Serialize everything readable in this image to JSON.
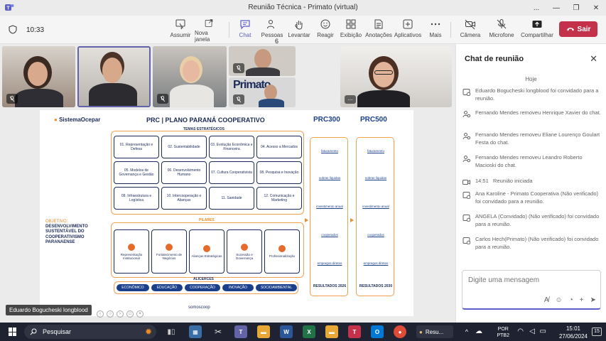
{
  "window": {
    "title": "Reunião Técnica - Primato (virtual)",
    "controls": [
      "...",
      "—",
      "❐",
      "✕"
    ]
  },
  "toolbar": {
    "timer": "10:33",
    "items": [
      {
        "label": "Assumir"
      },
      {
        "label": "Nova janela"
      },
      {
        "label": "Chat"
      },
      {
        "label": "Pessoas",
        "count": "6"
      },
      {
        "label": "Levantar"
      },
      {
        "label": "Reagir"
      },
      {
        "label": "Exibição"
      },
      {
        "label": "Anotações"
      },
      {
        "label": "Aplicativos"
      },
      {
        "label": "Mais"
      },
      {
        "label": "Câmera"
      },
      {
        "label": "Microfone"
      },
      {
        "label": "Compartilhar"
      }
    ],
    "leave_label": "Sair",
    "active_tab": "Chat",
    "accent_color": "#5b5fc7",
    "leave_color": "#c4314b"
  },
  "stage": {
    "presenter_name": "Eduardo Bogucheski longblood",
    "tile_more": "..."
  },
  "slide": {
    "brand": "SistemaOcepar",
    "title": "PRC | PLANO PARANÁ COOPERATIVO",
    "themes_label": "TEMAS ESTRATÉGICOS",
    "themes": [
      "01. Representação e Defesa",
      "02. Sustentabilidade",
      "03. Evolução Econômica e Financeira",
      "04. Acesso a Mercados",
      "05. Modelos de Governança e Gestão",
      "06. Desenvolvimento Humano",
      "07. Cultura Cooperativista",
      "08. Pesquisa e Inovação",
      "09. Infraestrutura e Logística",
      "10. Intercooperação e Alianças",
      "11. Sanidade",
      "12. Comunicação e Marketing"
    ],
    "objective_label": "OBJETIVO:",
    "objective_text": "DESENVOLVIMENTO SUSTENTÁVEL DO COOPERATIVISMO PARANAENSE",
    "pillars_label": "PILARES",
    "pillars": [
      "Representação Institucional",
      "Fortalecimento de Negócios",
      "Alianças Estratégicas",
      "Sucessão e Governança",
      "Profissionalização"
    ],
    "foundations_label": "ALICERCES",
    "foundations": [
      "ECONÔMICO",
      "EDUCAÇÃO",
      "COOPERAÇÃO",
      "INOVAÇÃO",
      "SOCIOAMBIENTAL"
    ],
    "footer": "somoscoop",
    "prc_columns": [
      {
        "title": "PRC300",
        "items": [
          "faturamento",
          "sobras líquidas",
          "investimento anual",
          "cooperados",
          "empregos diretos"
        ],
        "result": "RESULTADOS 2026"
      },
      {
        "title": "PRC500",
        "items": [
          "faturamento",
          "sobras líquidas",
          "investimento anual",
          "cooperados",
          "empregos diretos"
        ],
        "result": "RESULTADOS 2030"
      }
    ]
  },
  "chat": {
    "title": "Chat de reunião",
    "close_label": "✕",
    "date": "Hoje",
    "events": [
      {
        "icon": "user-add-icon",
        "text": "Eduardo Bogucheski longblood foi convidado para a reunião."
      },
      {
        "icon": "user-remove-icon",
        "text": "Fernando Mendes removeu Henrique Xavier do chat."
      },
      {
        "icon": "user-remove-icon",
        "text": "Fernando Mendes removeu Eliane Lourenço Goulart Festa do chat."
      },
      {
        "icon": "user-remove-icon",
        "text": "Fernando Mendes removeu Leandro Roberto Macioski do chat."
      },
      {
        "icon": "video-icon",
        "time": "14:51",
        "text": "Reunião iniciada"
      },
      {
        "icon": "user-add-icon",
        "text": "Ana Karoline - Primato Cooperativa (Não verificado) foi convidado para a reunião."
      },
      {
        "icon": "user-add-icon",
        "text": "ANGELA (Convidado) (Não verificado) foi convidado para a reunião."
      },
      {
        "icon": "user-add-icon",
        "text": "Carlos Hech(Primato) (Não verificado) foi convidado para a reunião."
      }
    ],
    "compose_placeholder": "Digite uma mensagem"
  },
  "taskbar": {
    "search_label": "Pesquisar",
    "lang": "POR",
    "lang_sub": "PTB2",
    "time": "15:01",
    "date": "27/06/2024",
    "notification_count": "15",
    "active_app_label": "Resu..."
  }
}
